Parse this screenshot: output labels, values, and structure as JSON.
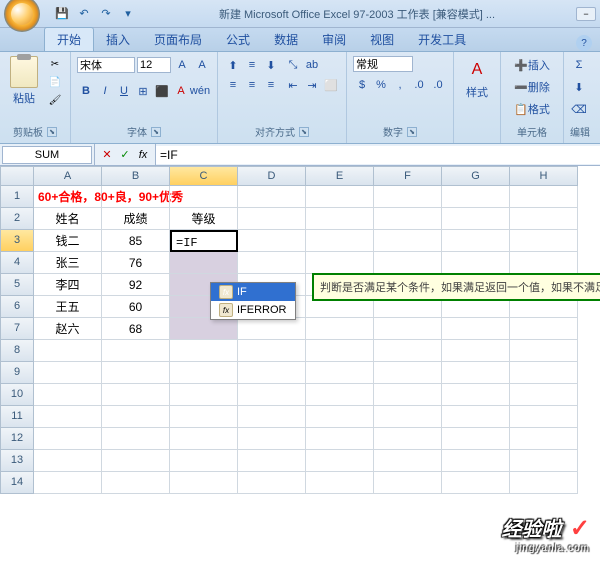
{
  "title": "新建 Microsoft Office Excel 97-2003 工作表  [兼容模式] ...",
  "tabs": [
    "开始",
    "插入",
    "页面布局",
    "公式",
    "数据",
    "审阅",
    "视图",
    "开发工具"
  ],
  "ribbon": {
    "paste": "粘贴",
    "clipboard": "剪贴板",
    "font_name": "宋体",
    "font_size": "12",
    "font_label": "字体",
    "align_label": "对齐方式",
    "normal": "常规",
    "number_label": "数字",
    "styles": "样式",
    "cells_label": "单元格",
    "edit_label": "编辑"
  },
  "name_box": "SUM",
  "formula": "=IF",
  "col_headers": [
    "A",
    "B",
    "C",
    "D",
    "E",
    "F",
    "G",
    "H"
  ],
  "sheet": {
    "title_text": "60+合格，80+良，90+优秀",
    "headers": [
      "姓名",
      "成绩",
      "等级"
    ],
    "rows": [
      {
        "name": "钱二",
        "score": "85",
        "grade": "=IF"
      },
      {
        "name": "张三",
        "score": "76",
        "grade": ""
      },
      {
        "name": "李四",
        "score": "92",
        "grade": ""
      },
      {
        "name": "王五",
        "score": "60",
        "grade": ""
      },
      {
        "name": "赵六",
        "score": "68",
        "grade": ""
      }
    ]
  },
  "autocomplete": {
    "items": [
      "IF",
      "IFERROR"
    ],
    "description": "判断是否满足某个条件，如果满足返回一个值，如果不满足"
  },
  "watermark": {
    "main": "经验啦",
    "sub": "jingyanla.com"
  }
}
